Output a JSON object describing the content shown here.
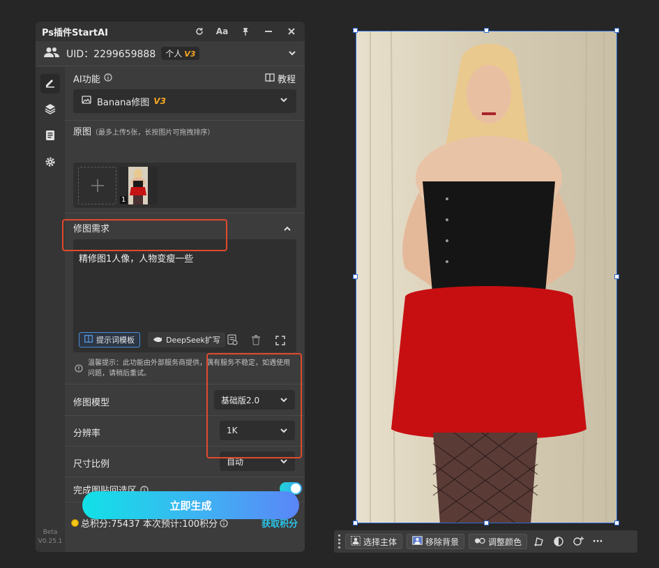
{
  "panel": {
    "title": "Ps插件StartAI",
    "font_size_button": "Aa",
    "user": {
      "uid_text": "UID：2299659888",
      "plan_label": "个人",
      "plan_version": "V3"
    },
    "ai_function": {
      "label": "AI功能",
      "tutorial_label": "教程",
      "selected": "Banana修图",
      "selected_version": "V3"
    },
    "original": {
      "label": "原图",
      "hint": "（最多上传5张，长按图片可拖拽排序）",
      "thumb_index": "1"
    },
    "requirement": {
      "label": "修图需求",
      "prompt_text": "精修图1人像，人物变瘦一些",
      "template_button": "提示词模板",
      "deepseek_button": "DeepSeek扩写"
    },
    "notice": "温馨提示：此功能由外部服务商提供，偶有服务不稳定，如遇使用问题，请稍后重试。",
    "settings": {
      "model_label": "修图模型",
      "model_value": "基础版2.0",
      "resolution_label": "分辨率",
      "resolution_value": "1K",
      "ratio_label": "尺寸比例",
      "ratio_value": "自动",
      "paste_back_label": "完成图贴回选区",
      "paste_back_enabled": true
    },
    "points": {
      "text": "总积分:75437  本次预计:100积分",
      "get_points": "获取积分"
    },
    "generate_button": "立即生成",
    "version": {
      "tag": "Beta",
      "number": "V0.25.1"
    }
  },
  "taskbar": {
    "select_subject": "选择主体",
    "remove_background": "移除背景",
    "adjust_color": "调整颜色",
    "more": "···"
  },
  "colors": {
    "accent_red": "#e14a2c",
    "accent_cyan": "#11e1e6",
    "accent_blue": "#5a86f6",
    "version_orange": "#f5a623",
    "selection_blue": "#2c6bd8"
  }
}
